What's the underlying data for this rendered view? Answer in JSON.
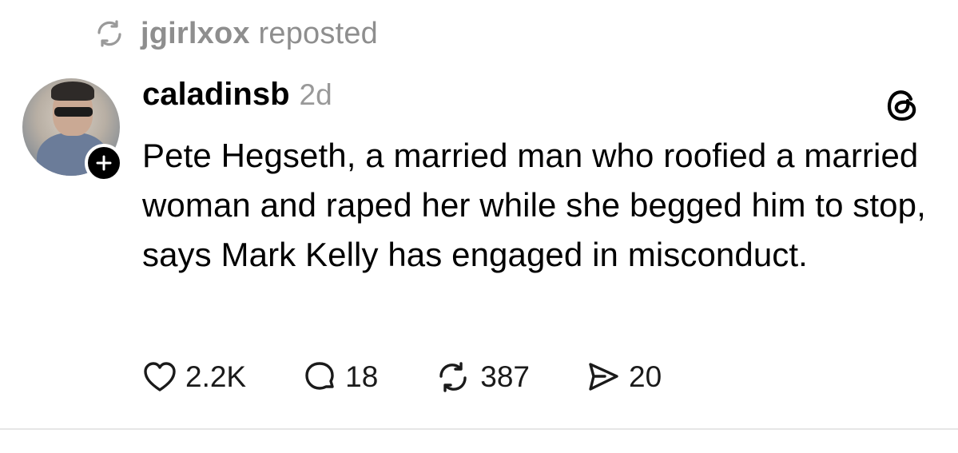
{
  "repost": {
    "user": "jgirlxox",
    "label": " reposted",
    "icon": "repost-icon"
  },
  "post": {
    "username": "caladinsb",
    "timestamp": "2d",
    "text": "Pete Hegseth, a married man who roofied a married woman and raped her while she begged him to stop, says Mark Kelly has engaged in misconduct."
  },
  "actions": {
    "likes": "2.2K",
    "replies": "18",
    "reposts": "387",
    "shares": "20"
  },
  "colors": {
    "muted": "#8e8e8e",
    "text": "#000000",
    "divider": "#e6e6e6"
  }
}
